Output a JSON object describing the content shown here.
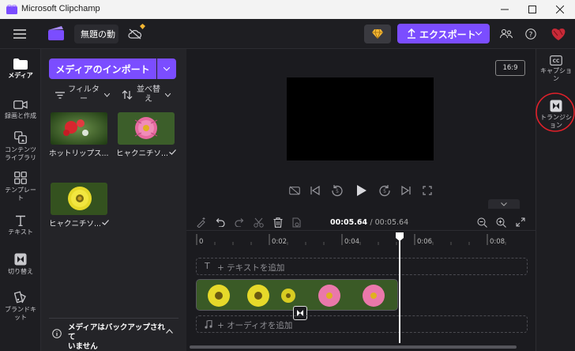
{
  "window": {
    "title": "Microsoft Clipchamp"
  },
  "header": {
    "project_name": "無題の動",
    "export_label": "エクスポート"
  },
  "nav": {
    "items": [
      {
        "label": "メディア",
        "icon": "folder-icon",
        "active": true
      },
      {
        "label": "録画と作成",
        "icon": "video-camera-icon"
      },
      {
        "label": "コンテンツ\nライブラリ",
        "icon": "content-library-icon"
      },
      {
        "label": "テンプレー\nト",
        "icon": "templates-icon"
      },
      {
        "label": "テキスト",
        "icon": "text-icon"
      },
      {
        "label": "切り替え",
        "icon": "transitions-icon"
      },
      {
        "label": "ブランドキ\nット",
        "icon": "brand-kit-icon"
      }
    ]
  },
  "media": {
    "import_label": "メディアのインポート",
    "filter_label": "フィルタ\nー",
    "sort_label": "並べ替\nえ",
    "items": [
      {
        "caption": "ホットリップス...",
        "checked": false,
        "kind": "red"
      },
      {
        "caption": "ヒャクニチソ...",
        "checked": true,
        "kind": "pink"
      },
      {
        "caption": "ヒャクニチソ...",
        "checked": true,
        "kind": "yellow"
      }
    ],
    "backup_text": "メディアはバックアップされて\nいません"
  },
  "preview": {
    "aspect_ratio": "16:9"
  },
  "rightbar": {
    "items": [
      {
        "label": "キャプショ\nン",
        "icon": "captions-icon"
      },
      {
        "label": "トランジシ\nョン",
        "icon": "transition-icon",
        "highlighted": true
      }
    ]
  },
  "timeline": {
    "current_time": "00:05.64",
    "total_time": "00:05.64",
    "ticks": [
      "0",
      "0:02",
      "0:04",
      "0:06",
      "0:08"
    ],
    "text_track_label": "+ テキストを追加",
    "audio_track_label": "+ オーディオを追加"
  },
  "colors": {
    "accent": "#7b4dff",
    "highlight_circle": "#e0202a"
  }
}
